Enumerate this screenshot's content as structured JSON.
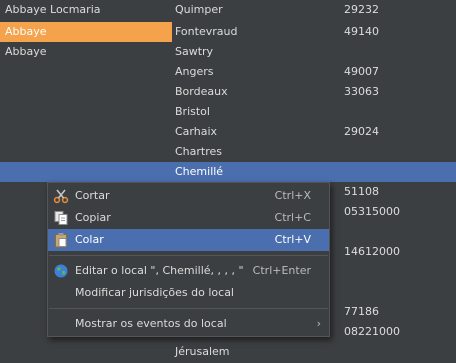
{
  "table": {
    "rows": [
      {
        "name": "Abbaye Locmaria",
        "city": "Quimper",
        "code": "29232",
        "state": "normal"
      },
      {
        "name": "Abbaye",
        "city": "Fontevraud",
        "code": "49140",
        "state": "orange"
      },
      {
        "name": "Abbaye",
        "city": "Sawtry",
        "code": "",
        "state": "normal"
      },
      {
        "name": "",
        "city": "Angers",
        "code": "49007",
        "state": "normal"
      },
      {
        "name": "",
        "city": "Bordeaux",
        "code": "33063",
        "state": "normal"
      },
      {
        "name": "",
        "city": "Bristol",
        "code": "",
        "state": "normal"
      },
      {
        "name": "",
        "city": "Carhaix",
        "code": "29024",
        "state": "normal"
      },
      {
        "name": "",
        "city": "Chartres",
        "code": "",
        "state": "normal"
      },
      {
        "name": "",
        "city": "Chemillé",
        "code": "",
        "state": "blue"
      },
      {
        "name": "",
        "city": "",
        "code": "51108",
        "state": "normal"
      },
      {
        "name": "",
        "city": "",
        "code": "05315000",
        "state": "normal"
      },
      {
        "name": "",
        "city": "",
        "code": "",
        "state": "normal"
      },
      {
        "name": "",
        "city": "",
        "code": "14612000",
        "state": "normal"
      },
      {
        "name": "",
        "city": "",
        "code": "",
        "state": "normal"
      },
      {
        "name": "",
        "city": "",
        "code": "",
        "state": "normal"
      },
      {
        "name": "",
        "city": "",
        "code": "77186",
        "state": "normal"
      },
      {
        "name": "",
        "city": "",
        "code": "08221000",
        "state": "normal"
      },
      {
        "name": "",
        "city": "Jérusalem",
        "code": "",
        "state": "normal"
      }
    ]
  },
  "context_menu": {
    "items": [
      {
        "label": "Cortar",
        "accel": "Ctrl+X",
        "icon": "scissors-icon",
        "highlighted": false
      },
      {
        "label": "Copiar",
        "accel": "Ctrl+C",
        "icon": "copy-icon",
        "highlighted": false
      },
      {
        "label": "Colar",
        "accel": "Ctrl+V",
        "icon": "paste-icon",
        "highlighted": true
      },
      {
        "label": "Editar o local \", Chemillé, , , , \"",
        "accel": "Ctrl+Enter",
        "icon": "globe-icon",
        "highlighted": false
      },
      {
        "label": "Modificar jurisdições do local",
        "accel": "",
        "icon": "",
        "highlighted": false
      },
      {
        "label": "Mostrar os eventos do local",
        "accel": "",
        "icon": "",
        "highlighted": false,
        "submenu_glyph": "›"
      }
    ]
  },
  "colors": {
    "background": "#3c3f41",
    "selection_blue": "#4b6eaf",
    "selection_orange": "#f5a24c"
  }
}
